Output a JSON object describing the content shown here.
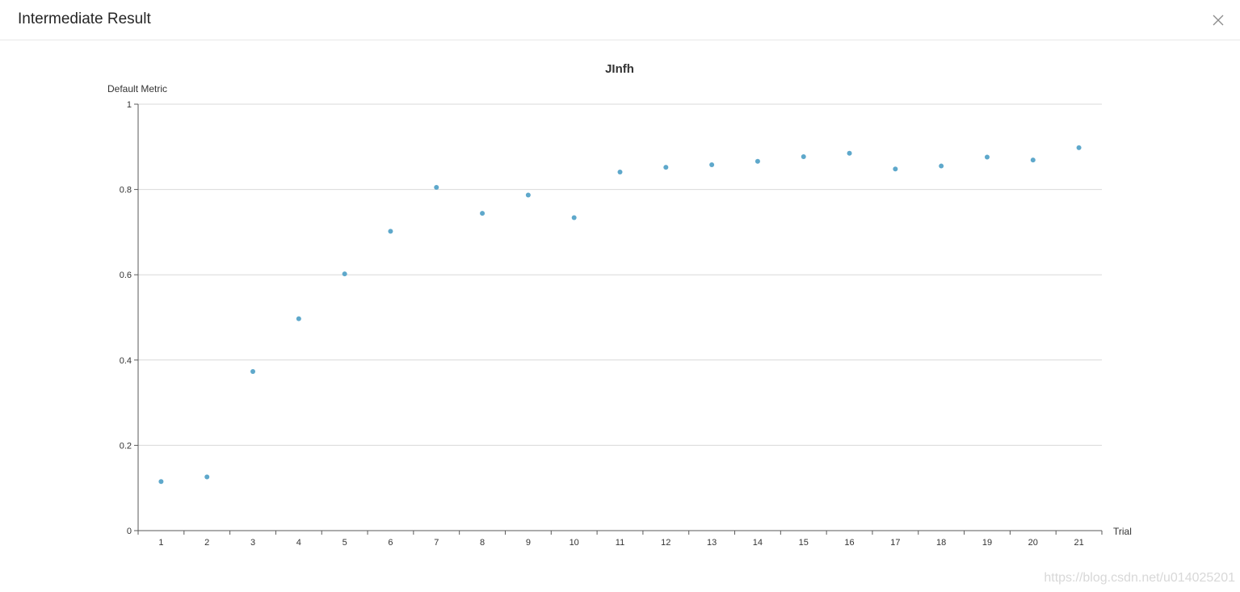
{
  "modal": {
    "title": "Intermediate Result",
    "close_icon": "close-icon"
  },
  "watermark": "https://blog.csdn.net/u014025201",
  "colors": {
    "point": "#5ea8cb",
    "grid": "#d9d9d9",
    "axis": "#595959",
    "text": "#333333"
  },
  "chart_data": {
    "type": "scatter",
    "title": "JInfh",
    "xlabel": "Trial",
    "ylabel": "Default Metric",
    "ylim": [
      0,
      1
    ],
    "yticks": [
      0,
      0.2,
      0.4,
      0.6,
      0.8,
      1
    ],
    "ytick_labels": [
      "0",
      "0.2",
      "0.4",
      "0.6",
      "0.8",
      "1"
    ],
    "grid": true,
    "x": [
      1,
      2,
      3,
      4,
      5,
      6,
      7,
      8,
      9,
      10,
      11,
      12,
      13,
      14,
      15,
      16,
      17,
      18,
      19,
      20,
      21
    ],
    "x_labels": [
      "1",
      "2",
      "3",
      "4",
      "5",
      "6",
      "7",
      "8",
      "9",
      "10",
      "11",
      "12",
      "13",
      "14",
      "15",
      "16",
      "17",
      "18",
      "19",
      "20",
      "21"
    ],
    "y": [
      0.115,
      0.126,
      0.373,
      0.497,
      0.602,
      0.702,
      0.805,
      0.744,
      0.787,
      0.734,
      0.841,
      0.852,
      0.858,
      0.866,
      0.877,
      0.885,
      0.848,
      0.855,
      0.876,
      0.869,
      0.898
    ]
  }
}
